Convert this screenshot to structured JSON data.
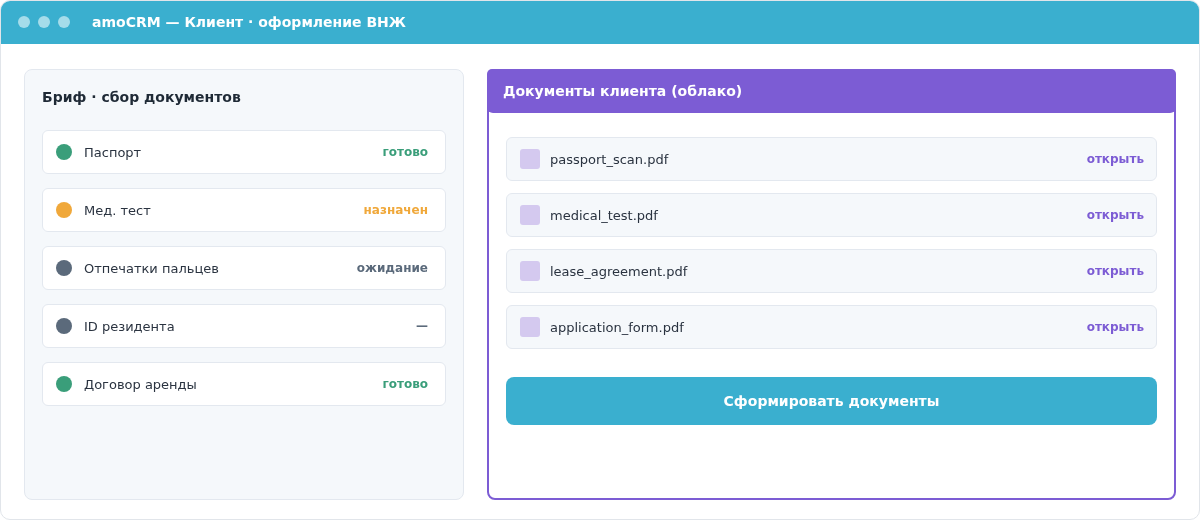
{
  "window": {
    "title": "amoCRM — Клиент · оформление ВНЖ"
  },
  "brief": {
    "title": "Бриф · сбор документов",
    "items": [
      {
        "label": "Паспорт",
        "status": "готово",
        "color": "#3a9e7a"
      },
      {
        "label": "Мед. тест",
        "status": "назначен",
        "color": "#f0a83a"
      },
      {
        "label": "Отпечатки пальцев",
        "status": "ожидание",
        "color": "#5b6a7b"
      },
      {
        "label": "ID резидента",
        "status": "—",
        "color": "#5b6a7b"
      },
      {
        "label": "Договор аренды",
        "status": "готово",
        "color": "#3a9e7a"
      }
    ]
  },
  "documents": {
    "title": "Документы клиента (облако)",
    "files": [
      {
        "name": "passport_scan.pdf",
        "action": "открыть"
      },
      {
        "name": "medical_test.pdf",
        "action": "открыть"
      },
      {
        "name": "lease_agreement.pdf",
        "action": "открыть"
      },
      {
        "name": "application_form.pdf",
        "action": "открыть"
      }
    ],
    "button": "Сформировать документы"
  }
}
